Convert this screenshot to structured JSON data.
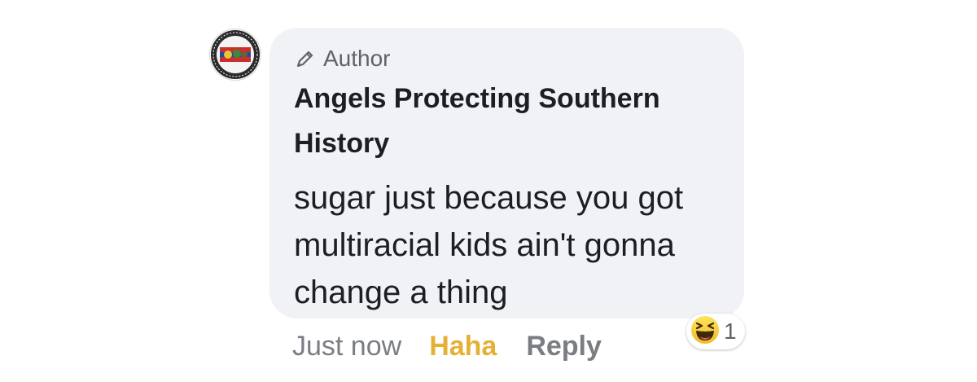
{
  "comment": {
    "author_badge": "Author",
    "name": "Angels Protecting Southern History",
    "text": "sugar just because you got multiracial kids ain't gonna change a thing"
  },
  "actions": {
    "timestamp": "Just now",
    "reaction_label": "Haha",
    "reply_label": "Reply"
  },
  "reactions": {
    "icon": "haha-emoji-icon",
    "count": "1"
  },
  "colors": {
    "bubble": "#f0f2f5",
    "haha": "#e5b134",
    "muted": "#7a7d82",
    "text": "#1c1e21"
  }
}
